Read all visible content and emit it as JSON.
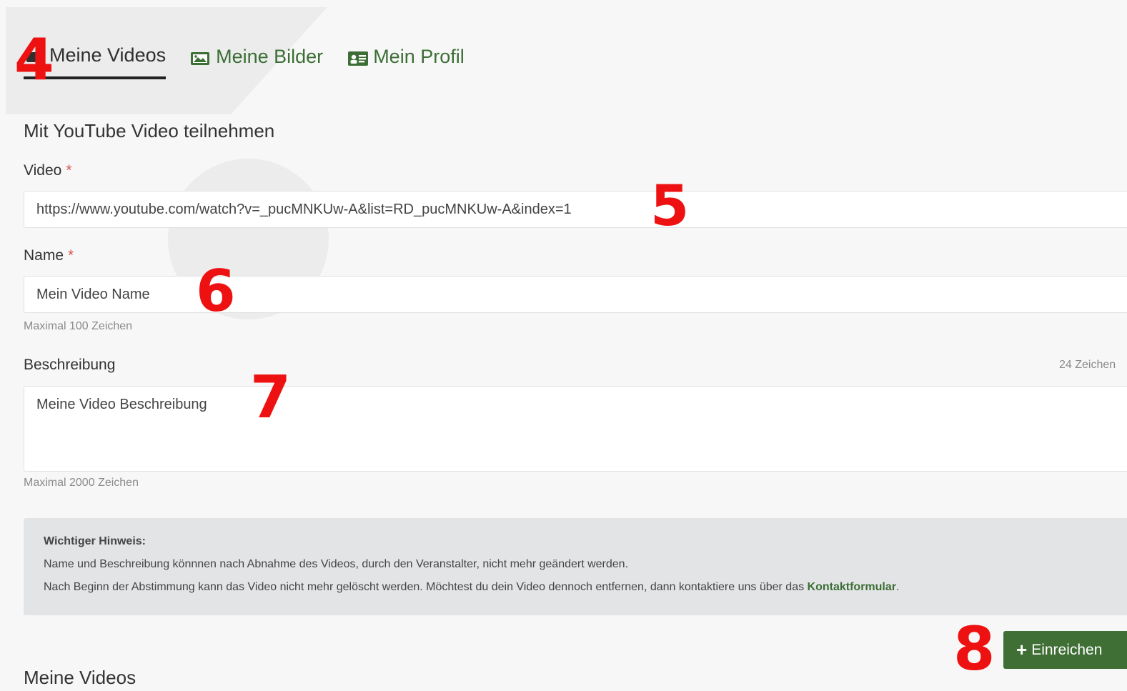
{
  "tabs": [
    {
      "label": "Meine Videos",
      "icon": "video-icon",
      "active": true
    },
    {
      "label": "Meine Bilder",
      "icon": "image-icon",
      "active": false
    },
    {
      "label": "Mein Profil",
      "icon": "profile-card-icon",
      "active": false
    }
  ],
  "form": {
    "section_title": "Mit YouTube Video teilnehmen",
    "video": {
      "label": "Video",
      "required_mark": "*",
      "value": "https://www.youtube.com/watch?v=_pucMNKUw-A&list=RD_pucMNKUw-A&index=1"
    },
    "name": {
      "label": "Name",
      "required_mark": "*",
      "value": "Mein Video Name",
      "hint": "Maximal 100 Zeichen"
    },
    "description": {
      "label": "Beschreibung",
      "counter": "24 Zeichen",
      "value": "Meine Video Beschreibung",
      "hint": "Maximal 2000 Zeichen"
    }
  },
  "notice": {
    "title": "Wichtiger Hinweis:",
    "line1": "Name und Beschreibung könnnen nach Abnahme des Videos, durch den Veranstalter, nicht mehr geändert werden.",
    "line2_text": "Nach Beginn der Abstimmung kann das Video nicht mehr gelöscht werden. Möchtest du dein Video dennoch entfernen, dann kontaktiere uns über das",
    "line2_link": "Kontaktformular",
    "line2_end": "."
  },
  "submit_button": {
    "icon": "plus-icon",
    "label": "Einreichen"
  },
  "bottom_title": "Meine Videos",
  "markers": [
    "4",
    "5",
    "6",
    "7",
    "8"
  ],
  "colors": {
    "accent": "#3f6f35",
    "link": "#3c6e35",
    "marker": "#ee1111",
    "required": "#d9534f"
  }
}
